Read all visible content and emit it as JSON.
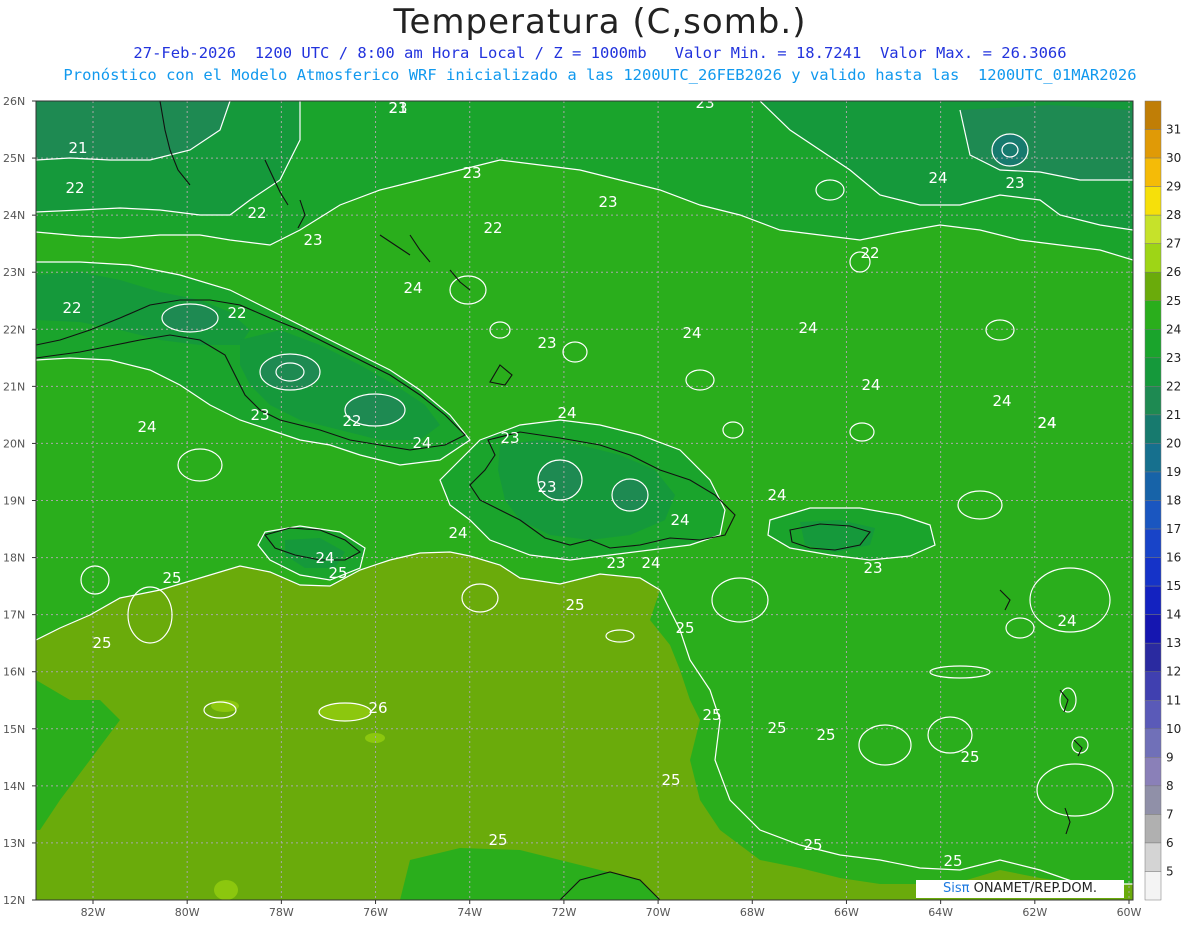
{
  "header": {
    "title": "Temperatura (C,somb.)",
    "line1": "27-Feb-2026  1200 UTC / 8:00 am Hora Local / Z = 1000mb   Valor Min. = 18.7241  Valor Max. = 26.3066",
    "line2": "Pronóstico con el Modelo Atmosferico WRF inicializado a las 1200UTC_26FEB2026 y valido hasta las  1200UTC_01MAR2026"
  },
  "map": {
    "lat_labels": [
      "26N",
      "25N",
      "24N",
      "23N",
      "22N",
      "21N",
      "20N",
      "19N",
      "18N",
      "17N",
      "16N",
      "15N",
      "14N",
      "13N",
      "12N"
    ],
    "lon_labels": [
      "82W",
      "80W",
      "78W",
      "76W",
      "74W",
      "72W",
      "70W",
      "68W",
      "66W",
      "64W",
      "62W",
      "60W"
    ],
    "contour_labels": [
      "23",
      "23",
      "23",
      "21",
      "22",
      "22",
      "23",
      "24",
      "23",
      "22",
      "23",
      "22",
      "24",
      "22",
      "22",
      "23",
      "24",
      "24",
      "23",
      "24",
      "24",
      "22",
      "24",
      "23",
      "24",
      "24",
      "23",
      "24",
      "24",
      "24",
      "24",
      "23",
      "23",
      "24",
      "25",
      "25",
      "25",
      "25",
      "26",
      "25",
      "25",
      "25",
      "25",
      "25",
      "25",
      "25",
      "25",
      "25",
      "24",
      "24",
      "24",
      "21"
    ],
    "colors": {
      "t21": "#1e8a52",
      "t22": "#15993b",
      "t23": "#1aa42c",
      "t24": "#2aae1c",
      "t25": "#6aab0b",
      "t26": "#8cc70e",
      "coast": "#111111",
      "contour": "#ffffff",
      "grid": "#aaaaaa"
    }
  },
  "legend": {
    "items": [
      {
        "label": "31",
        "color": "#c07e06"
      },
      {
        "label": "30",
        "color": "#e09a06"
      },
      {
        "label": "29",
        "color": "#f5bb07"
      },
      {
        "label": "28",
        "color": "#f6e00a"
      },
      {
        "label": "27",
        "color": "#c6e22a"
      },
      {
        "label": "26",
        "color": "#9ed516"
      },
      {
        "label": "25",
        "color": "#6aab0b"
      },
      {
        "label": "24",
        "color": "#2aae1c"
      },
      {
        "label": "23",
        "color": "#1aa42c"
      },
      {
        "label": "22",
        "color": "#15993b"
      },
      {
        "label": "21",
        "color": "#1e8a52"
      },
      {
        "label": "20",
        "color": "#177a6e"
      },
      {
        "label": "19",
        "color": "#16708e"
      },
      {
        "label": "18",
        "color": "#1763a8"
      },
      {
        "label": "17",
        "color": "#1a56c0"
      },
      {
        "label": "16",
        "color": "#1844c8"
      },
      {
        "label": "15",
        "color": "#1533c8"
      },
      {
        "label": "14",
        "color": "#1322c0"
      },
      {
        "label": "13",
        "color": "#1516b0"
      },
      {
        "label": "12",
        "color": "#2a2aa0"
      },
      {
        "label": "11",
        "color": "#4040b0"
      },
      {
        "label": "10",
        "color": "#5a5ab8"
      },
      {
        "label": "9",
        "color": "#7070b8"
      },
      {
        "label": "8",
        "color": "#8a80b8"
      },
      {
        "label": "7",
        "color": "#9090a8"
      },
      {
        "label": "6",
        "color": "#b0b0b0"
      },
      {
        "label": "5",
        "color": "#d4d4d4"
      },
      {
        "label": "",
        "color": "#f4f4f4"
      }
    ]
  },
  "watermark": {
    "brand": "Sisπ",
    "rest": " ONAMET/REP.DOM."
  }
}
